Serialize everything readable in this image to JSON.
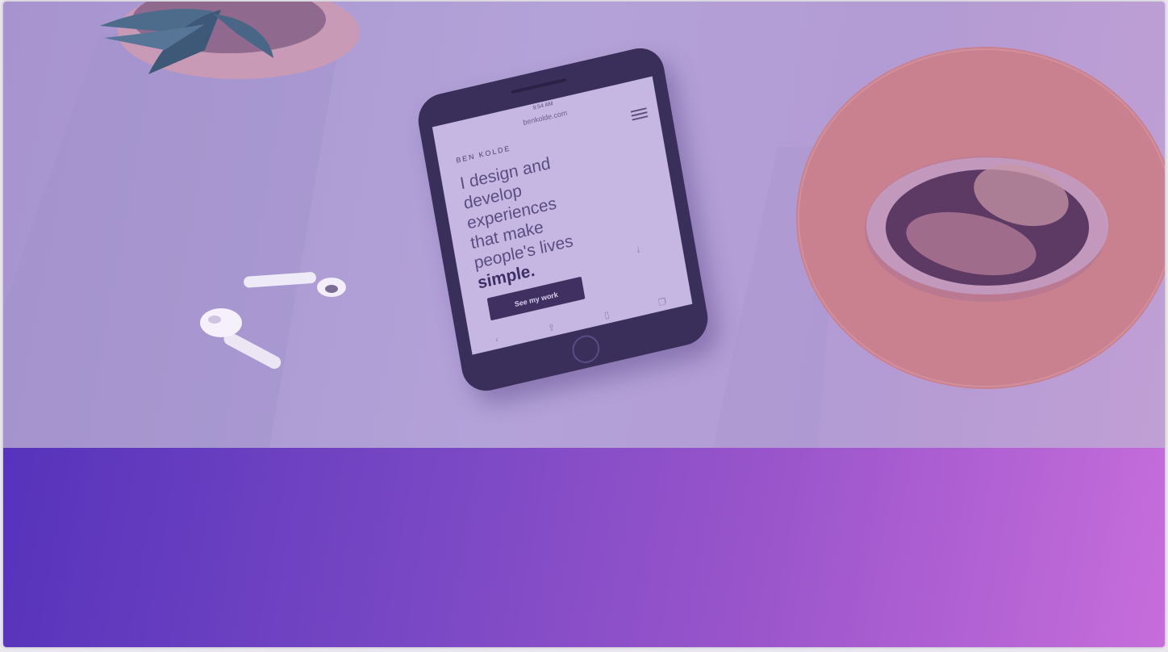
{
  "colors": {
    "hero_overlay": "#b3a2d8",
    "band_start": "#5633bb",
    "band_end": "#c76ddb",
    "phone_body": "#3a2f5a",
    "cta_bg": "#3f3061"
  },
  "phone_screen": {
    "status_time": "9:54 AM",
    "url": "benkolde.com",
    "brand": "BEN KOLDE",
    "headline_lines": [
      "I design and",
      "develop",
      "experiences",
      "that make",
      "people's lives"
    ],
    "headline_bold": "simple.",
    "cta_label": "See my work",
    "icons": {
      "menu": "hamburger-icon",
      "scroll": "arrow-down-icon",
      "back": "chevron-left-icon",
      "share": "share-icon",
      "bookmarks": "book-icon",
      "tabs": "tabs-icon"
    }
  }
}
